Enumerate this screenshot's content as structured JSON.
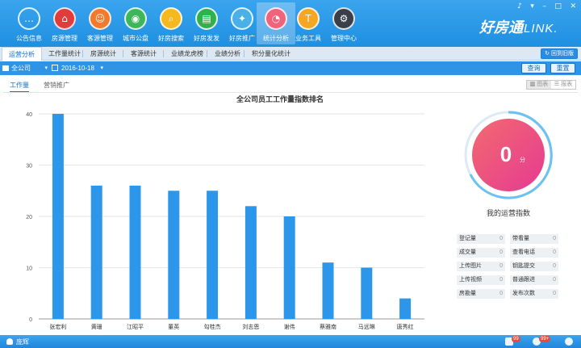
{
  "nav": [
    {
      "label": "公告信息",
      "icon": "announcement-icon",
      "glyph": "…"
    },
    {
      "label": "房源管理",
      "icon": "house-icon",
      "glyph": "⌂"
    },
    {
      "label": "客源管理",
      "icon": "customer-icon",
      "glyph": "☺"
    },
    {
      "label": "城市公盘",
      "icon": "city-pool-icon",
      "glyph": "◉"
    },
    {
      "label": "好房搜索",
      "icon": "search-icon",
      "glyph": "⌕"
    },
    {
      "label": "好房发发",
      "icon": "publish-icon",
      "glyph": "▤"
    },
    {
      "label": "好房推广",
      "icon": "promote-icon",
      "glyph": "✦"
    },
    {
      "label": "统计分析",
      "icon": "statistics-icon",
      "glyph": "◔"
    },
    {
      "label": "业务工具",
      "icon": "tools-icon",
      "glyph": "T"
    },
    {
      "label": "管理中心",
      "icon": "management-icon",
      "glyph": "⚙"
    }
  ],
  "brand": {
    "name": "好房通",
    "suffix": "LINK."
  },
  "subtabs": [
    "运营分析",
    "工作量统计",
    "房源统计",
    "客源统计",
    "业绩龙虎榜",
    "业绩分析",
    "积分量化统计"
  ],
  "refresh_label": "回到旧版",
  "filter": {
    "company": "全公司",
    "date": "2016-10-18",
    "query_label": "查询",
    "reset_label": "重置"
  },
  "content_tabs": [
    "工作量",
    "营销推广"
  ],
  "view_toggle": [
    "图表",
    "报表"
  ],
  "chart_data": {
    "type": "bar",
    "title": "全公司员工工作量指数排名",
    "categories": [
      "张宏利",
      "黄珊",
      "江昭平",
      "董英",
      "勾桂杰",
      "刘志恩",
      "谢伟",
      "蔡雅南",
      "马远琳",
      "唐秀红"
    ],
    "values": [
      40,
      26,
      26,
      25,
      25,
      22,
      20,
      11,
      10,
      4
    ],
    "ylim": [
      0,
      40
    ],
    "yticks": [
      0,
      10,
      20,
      30,
      40
    ],
    "grid": true,
    "bar_color": "#2b96ea"
  },
  "score": {
    "value": "0",
    "unit": "分",
    "label": "我的运营指数"
  },
  "stats": [
    {
      "label": "登记量",
      "value": "0"
    },
    {
      "label": "带看量",
      "value": "0"
    },
    {
      "label": "成交量",
      "value": "0"
    },
    {
      "label": "查看电话",
      "value": "0"
    },
    {
      "label": "上传图片",
      "value": "0"
    },
    {
      "label": "钥匙提交",
      "value": "0"
    },
    {
      "label": "上传视频",
      "value": "0"
    },
    {
      "label": "普通跟进",
      "value": "0"
    },
    {
      "label": "房勘量",
      "value": "0"
    },
    {
      "label": "发布次数",
      "value": "0"
    }
  ],
  "status": {
    "user": "庞辉",
    "badge1": "99",
    "badge2": "99+"
  },
  "colors": {
    "primary": "#2f93e6",
    "ring_start": "#f05b7a",
    "ring_end": "#e83f8f",
    "bar": "#2b96ea"
  }
}
